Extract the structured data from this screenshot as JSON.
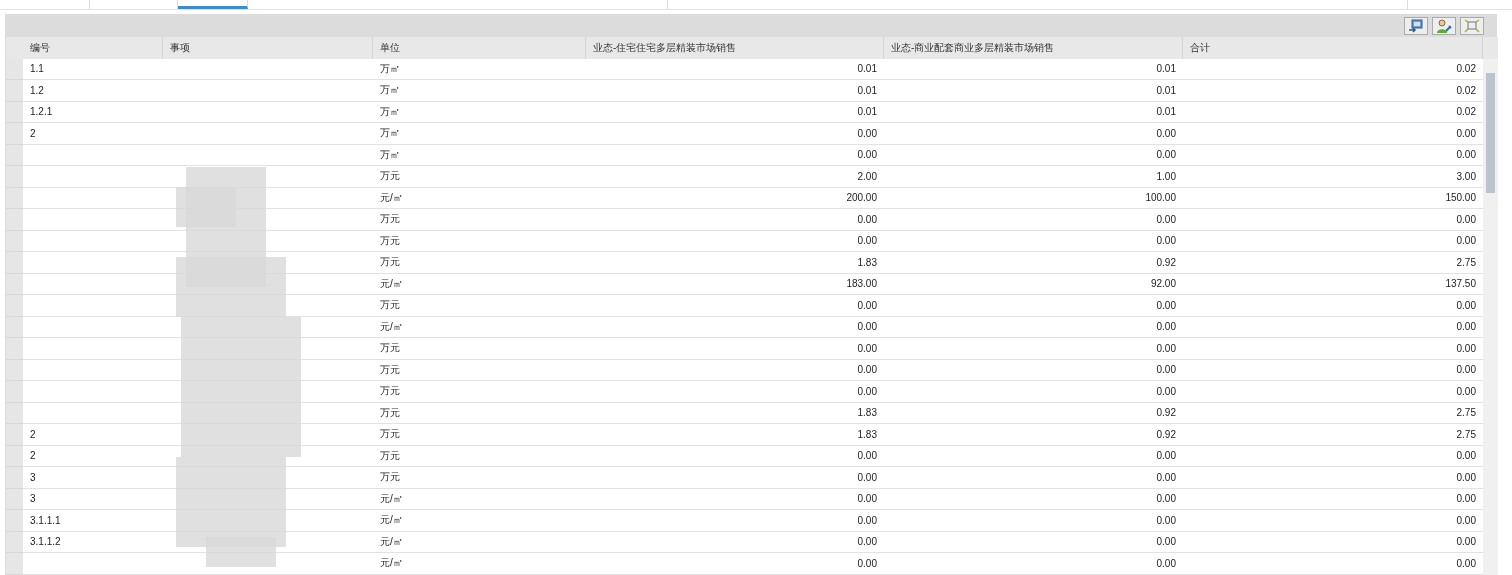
{
  "tabs": [
    {
      "selected": false
    },
    {
      "selected": false
    },
    {
      "selected": true
    },
    {
      "selected": false
    },
    {
      "selected": false
    }
  ],
  "toolbar": {
    "buttons": [
      {
        "kind": "export"
      },
      {
        "kind": "user-settings"
      },
      {
        "kind": "fit"
      }
    ]
  },
  "table": {
    "columns": [
      "编号",
      "事项",
      "单位",
      "业态-住宅住宅多层精装市场销售",
      "业态-商业配套商业多层精装市场销售",
      "合计"
    ],
    "rows": [
      {
        "code": "1.1",
        "unit": "万㎡",
        "col4": "0.01",
        "col5": "0.01",
        "total": "0.02"
      },
      {
        "code": "1.2",
        "unit": "万㎡",
        "col4": "0.01",
        "col5": "0.01",
        "total": "0.02"
      },
      {
        "code": "1.2.1",
        "unit": "万㎡",
        "col4": "0.01",
        "col5": "0.01",
        "total": "0.02"
      },
      {
        "code": "2",
        "unit": "万㎡",
        "col4": "0.00",
        "col5": "0.00",
        "total": "0.00"
      },
      {
        "unit": "万㎡",
        "col4": "0.00",
        "col5": "0.00",
        "total": "0.00"
      },
      {
        "unit": "万元",
        "col4": "2.00",
        "col5": "1.00",
        "total": "3.00"
      },
      {
        "unit": "元/㎡",
        "col4": "200.00",
        "col5": "100.00",
        "total": "150.00"
      },
      {
        "unit": "万元",
        "col4": "0.00",
        "col5": "0.00",
        "total": "0.00"
      },
      {
        "unit": "万元",
        "col4": "0.00",
        "col5": "0.00",
        "total": "0.00"
      },
      {
        "unit": "万元",
        "col4": "1.83",
        "col5": "0.92",
        "total": "2.75"
      },
      {
        "unit": "元/㎡",
        "col4": "183.00",
        "col5": "92.00",
        "total": "137.50"
      },
      {
        "unit": "万元",
        "col4": "0.00",
        "col5": "0.00",
        "total": "0.00"
      },
      {
        "unit": "元/㎡",
        "col4": "0.00",
        "col5": "0.00",
        "total": "0.00"
      },
      {
        "unit": "万元",
        "col4": "0.00",
        "col5": "0.00",
        "total": "0.00"
      },
      {
        "unit": "万元",
        "col4": "0.00",
        "col5": "0.00",
        "total": "0.00"
      },
      {
        "unit": "万元",
        "col4": "0.00",
        "col5": "0.00",
        "total": "0.00"
      },
      {
        "unit": "万元",
        "col4": "1.83",
        "col5": "0.92",
        "total": "2.75"
      },
      {
        "code": "2",
        "unit": "万元",
        "col4": "1.83",
        "col5": "0.92",
        "total": "2.75"
      },
      {
        "code": "2",
        "unit": "万元",
        "col4": "0.00",
        "col5": "0.00",
        "total": "0.00"
      },
      {
        "code": "3",
        "unit": "万元",
        "col4": "0.00",
        "col5": "0.00",
        "total": "0.00"
      },
      {
        "code": "3",
        "unit": "元/㎡",
        "col4": "0.00",
        "col5": "0.00",
        "total": "0.00"
      },
      {
        "code": "3.1.1.1",
        "unit": "元/㎡",
        "col4": "0.00",
        "col5": "0.00",
        "total": "0.00"
      },
      {
        "code": "3.1.1.2",
        "unit": "元/㎡",
        "col4": "0.00",
        "col5": "0.00",
        "total": "0.00"
      },
      {
        "unit": "元/㎡",
        "col4": "0.00",
        "col5": "0.00",
        "total": "0.00"
      }
    ]
  }
}
